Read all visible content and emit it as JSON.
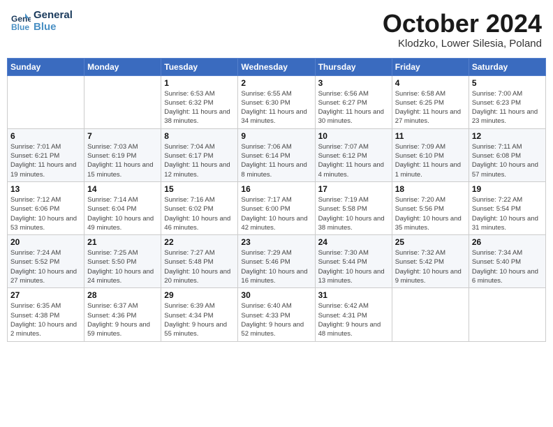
{
  "header": {
    "logo_line1": "General",
    "logo_line2": "Blue",
    "month_title": "October 2024",
    "location": "Klodzko, Lower Silesia, Poland"
  },
  "weekdays": [
    "Sunday",
    "Monday",
    "Tuesday",
    "Wednesday",
    "Thursday",
    "Friday",
    "Saturday"
  ],
  "weeks": [
    [
      {
        "day": "",
        "info": ""
      },
      {
        "day": "",
        "info": ""
      },
      {
        "day": "1",
        "info": "Sunrise: 6:53 AM\nSunset: 6:32 PM\nDaylight: 11 hours and 38 minutes."
      },
      {
        "day": "2",
        "info": "Sunrise: 6:55 AM\nSunset: 6:30 PM\nDaylight: 11 hours and 34 minutes."
      },
      {
        "day": "3",
        "info": "Sunrise: 6:56 AM\nSunset: 6:27 PM\nDaylight: 11 hours and 30 minutes."
      },
      {
        "day": "4",
        "info": "Sunrise: 6:58 AM\nSunset: 6:25 PM\nDaylight: 11 hours and 27 minutes."
      },
      {
        "day": "5",
        "info": "Sunrise: 7:00 AM\nSunset: 6:23 PM\nDaylight: 11 hours and 23 minutes."
      }
    ],
    [
      {
        "day": "6",
        "info": "Sunrise: 7:01 AM\nSunset: 6:21 PM\nDaylight: 11 hours and 19 minutes."
      },
      {
        "day": "7",
        "info": "Sunrise: 7:03 AM\nSunset: 6:19 PM\nDaylight: 11 hours and 15 minutes."
      },
      {
        "day": "8",
        "info": "Sunrise: 7:04 AM\nSunset: 6:17 PM\nDaylight: 11 hours and 12 minutes."
      },
      {
        "day": "9",
        "info": "Sunrise: 7:06 AM\nSunset: 6:14 PM\nDaylight: 11 hours and 8 minutes."
      },
      {
        "day": "10",
        "info": "Sunrise: 7:07 AM\nSunset: 6:12 PM\nDaylight: 11 hours and 4 minutes."
      },
      {
        "day": "11",
        "info": "Sunrise: 7:09 AM\nSunset: 6:10 PM\nDaylight: 11 hours and 1 minute."
      },
      {
        "day": "12",
        "info": "Sunrise: 7:11 AM\nSunset: 6:08 PM\nDaylight: 10 hours and 57 minutes."
      }
    ],
    [
      {
        "day": "13",
        "info": "Sunrise: 7:12 AM\nSunset: 6:06 PM\nDaylight: 10 hours and 53 minutes."
      },
      {
        "day": "14",
        "info": "Sunrise: 7:14 AM\nSunset: 6:04 PM\nDaylight: 10 hours and 49 minutes."
      },
      {
        "day": "15",
        "info": "Sunrise: 7:16 AM\nSunset: 6:02 PM\nDaylight: 10 hours and 46 minutes."
      },
      {
        "day": "16",
        "info": "Sunrise: 7:17 AM\nSunset: 6:00 PM\nDaylight: 10 hours and 42 minutes."
      },
      {
        "day": "17",
        "info": "Sunrise: 7:19 AM\nSunset: 5:58 PM\nDaylight: 10 hours and 38 minutes."
      },
      {
        "day": "18",
        "info": "Sunrise: 7:20 AM\nSunset: 5:56 PM\nDaylight: 10 hours and 35 minutes."
      },
      {
        "day": "19",
        "info": "Sunrise: 7:22 AM\nSunset: 5:54 PM\nDaylight: 10 hours and 31 minutes."
      }
    ],
    [
      {
        "day": "20",
        "info": "Sunrise: 7:24 AM\nSunset: 5:52 PM\nDaylight: 10 hours and 27 minutes."
      },
      {
        "day": "21",
        "info": "Sunrise: 7:25 AM\nSunset: 5:50 PM\nDaylight: 10 hours and 24 minutes."
      },
      {
        "day": "22",
        "info": "Sunrise: 7:27 AM\nSunset: 5:48 PM\nDaylight: 10 hours and 20 minutes."
      },
      {
        "day": "23",
        "info": "Sunrise: 7:29 AM\nSunset: 5:46 PM\nDaylight: 10 hours and 16 minutes."
      },
      {
        "day": "24",
        "info": "Sunrise: 7:30 AM\nSunset: 5:44 PM\nDaylight: 10 hours and 13 minutes."
      },
      {
        "day": "25",
        "info": "Sunrise: 7:32 AM\nSunset: 5:42 PM\nDaylight: 10 hours and 9 minutes."
      },
      {
        "day": "26",
        "info": "Sunrise: 7:34 AM\nSunset: 5:40 PM\nDaylight: 10 hours and 6 minutes."
      }
    ],
    [
      {
        "day": "27",
        "info": "Sunrise: 6:35 AM\nSunset: 4:38 PM\nDaylight: 10 hours and 2 minutes."
      },
      {
        "day": "28",
        "info": "Sunrise: 6:37 AM\nSunset: 4:36 PM\nDaylight: 9 hours and 59 minutes."
      },
      {
        "day": "29",
        "info": "Sunrise: 6:39 AM\nSunset: 4:34 PM\nDaylight: 9 hours and 55 minutes."
      },
      {
        "day": "30",
        "info": "Sunrise: 6:40 AM\nSunset: 4:33 PM\nDaylight: 9 hours and 52 minutes."
      },
      {
        "day": "31",
        "info": "Sunrise: 6:42 AM\nSunset: 4:31 PM\nDaylight: 9 hours and 48 minutes."
      },
      {
        "day": "",
        "info": ""
      },
      {
        "day": "",
        "info": ""
      }
    ]
  ]
}
